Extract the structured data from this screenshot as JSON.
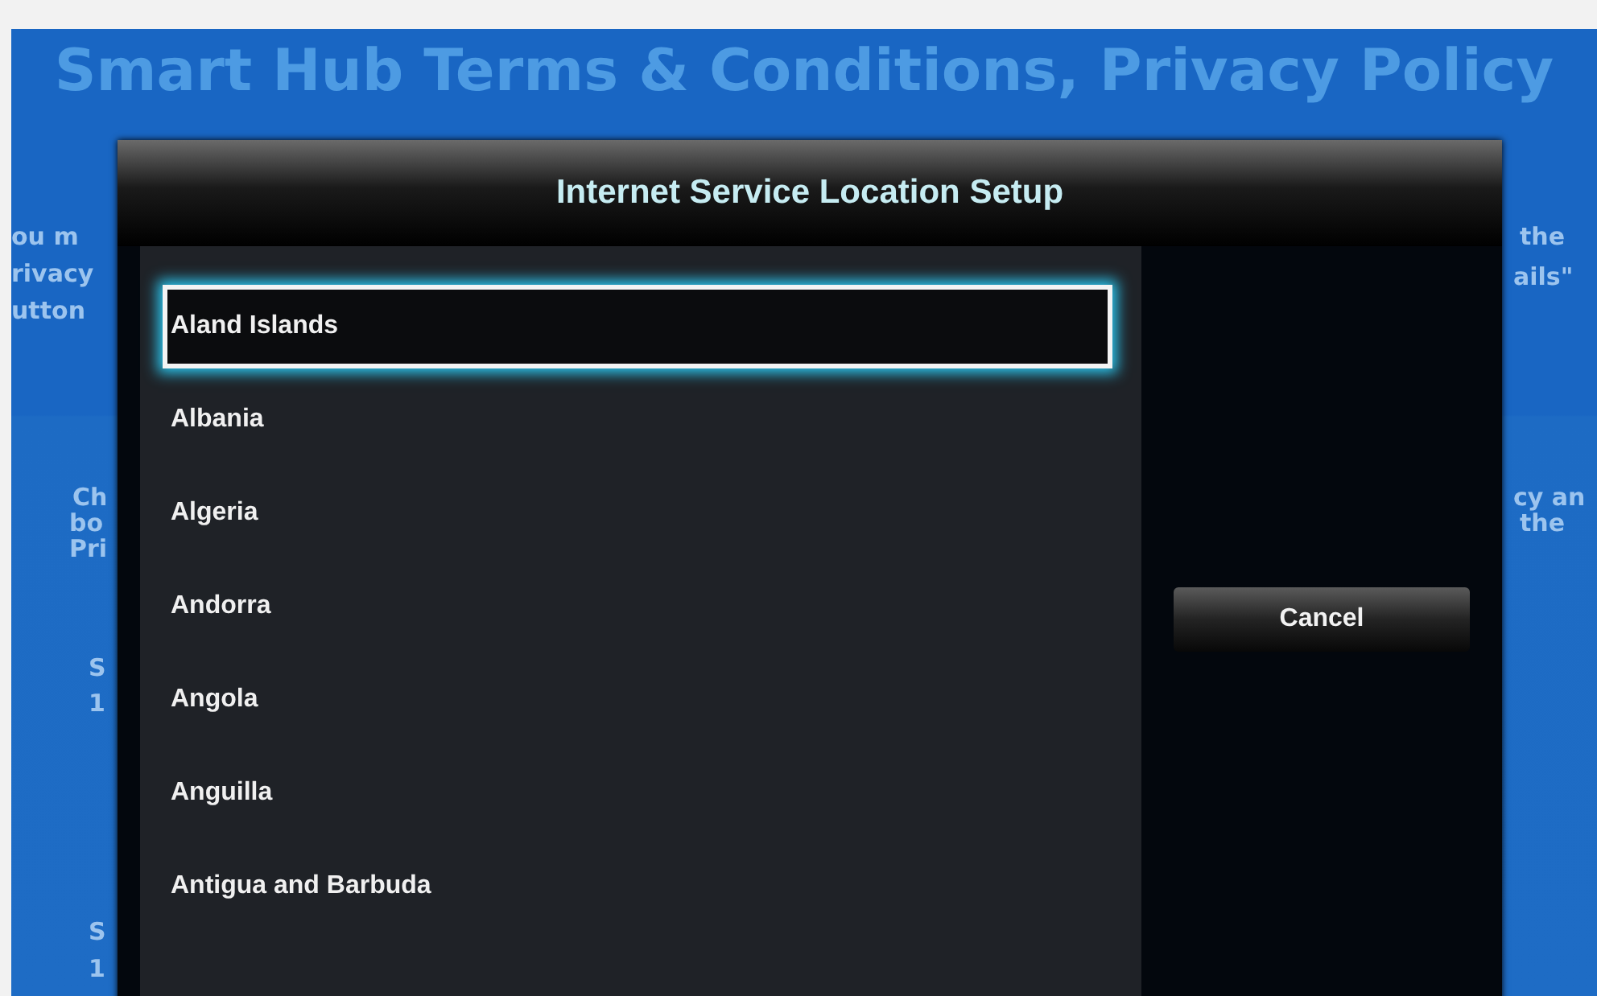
{
  "background": {
    "title": "Smart Hub Terms & Conditions, Privacy Policy",
    "left_fragments": [
      "ou m",
      "rivacy",
      "utton",
      "Ch",
      "bo",
      "Pri",
      "S",
      "1",
      "S",
      "1"
    ],
    "right_fragments": [
      "the",
      "ails\"",
      "cy an",
      "the"
    ]
  },
  "dialog": {
    "title": "Internet Service Location Setup",
    "countries": [
      {
        "name": "Aland Islands",
        "selected": true
      },
      {
        "name": "Albania",
        "selected": false
      },
      {
        "name": "Algeria",
        "selected": false
      },
      {
        "name": "Andorra",
        "selected": false
      },
      {
        "name": "Angola",
        "selected": false
      },
      {
        "name": "Anguilla",
        "selected": false
      },
      {
        "name": "Antigua and Barbuda",
        "selected": false
      }
    ],
    "cancel_button": "Cancel"
  }
}
